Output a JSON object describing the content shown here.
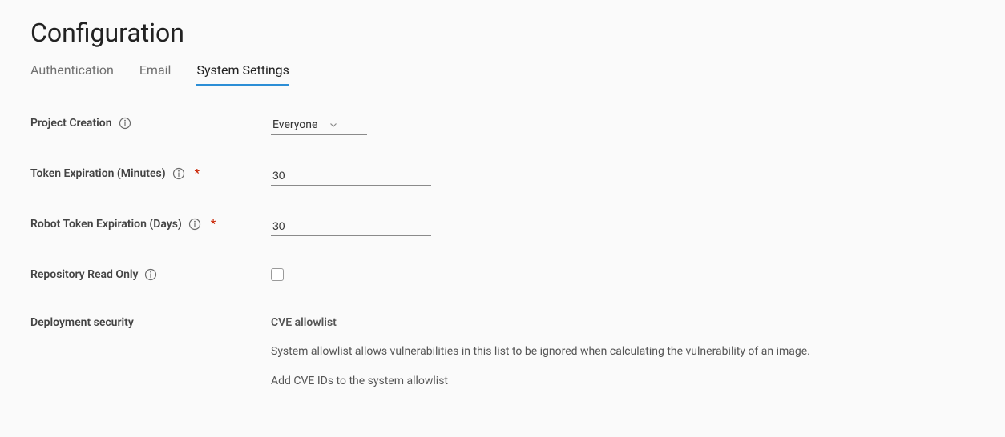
{
  "page_title": "Configuration",
  "tabs": {
    "authentication": "Authentication",
    "email": "Email",
    "system_settings": "System Settings"
  },
  "fields": {
    "project_creation": {
      "label": "Project Creation",
      "value": "Everyone"
    },
    "token_expiration": {
      "label": "Token Expiration (Minutes)",
      "value": "30"
    },
    "robot_token_expiration": {
      "label": "Robot Token Expiration (Days)",
      "value": "30"
    },
    "repo_read_only": {
      "label": "Repository Read Only"
    },
    "deployment_security": {
      "label": "Deployment security",
      "sub_title": "CVE allowlist",
      "desc": "System allowlist allows vulnerabilities in this list to be ignored when calculating the vulnerability of an image.",
      "hint": "Add CVE IDs to the system allowlist"
    }
  }
}
